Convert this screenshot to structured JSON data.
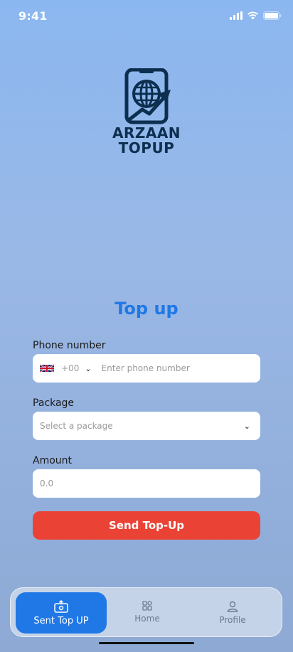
{
  "status_bar": {
    "time": "9:41"
  },
  "logo": {
    "line1": "ARZAAN",
    "line2": "TOPUP"
  },
  "page": {
    "title": "Top up"
  },
  "form": {
    "phone": {
      "label": "Phone number",
      "country_code": "+00",
      "placeholder": "Enter phone number",
      "flag": "uk-flag-icon"
    },
    "package": {
      "label": "Package",
      "placeholder": "Select a package"
    },
    "amount": {
      "label": "Amount",
      "placeholder": "0.0"
    },
    "submit_label": "Send Top-Up"
  },
  "nav": {
    "items": [
      {
        "label": "Sent Top UP",
        "icon": "sent-topup-icon",
        "active": true
      },
      {
        "label": "Home",
        "icon": "home-grid-icon",
        "active": false
      },
      {
        "label": "Profile",
        "icon": "profile-icon",
        "active": false
      }
    ]
  },
  "colors": {
    "accent": "#1f78e6",
    "button": "#ea4335",
    "logo": "#0d2f4f"
  }
}
